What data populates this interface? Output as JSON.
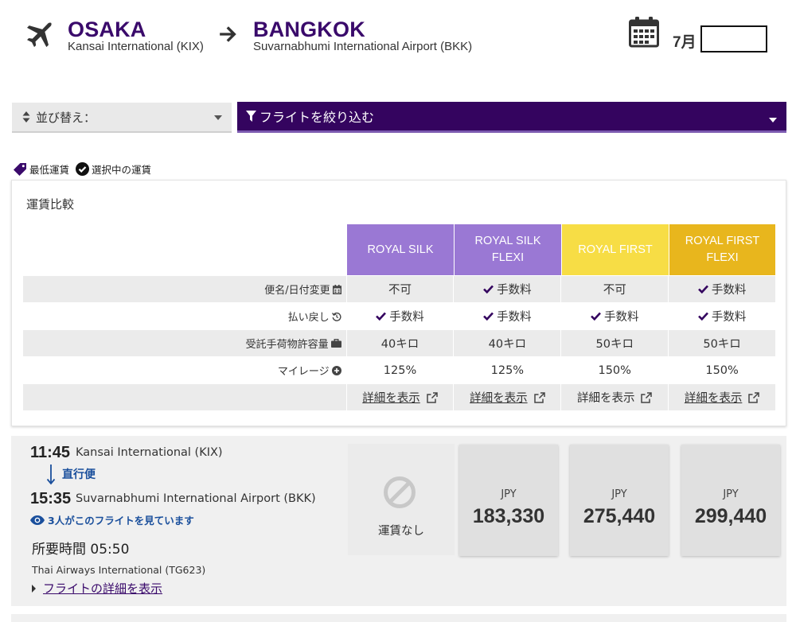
{
  "header": {
    "origin": {
      "city": "OSAKA",
      "airport": "Kansai International (KIX)"
    },
    "destination": {
      "city": "BANGKOK",
      "airport": "Suvarnabhumi International Airport (BKK)"
    },
    "month": "7月",
    "date_value": ""
  },
  "toolbar": {
    "sort_label": "並び替え：",
    "filter_label": "フライトを絞り込む"
  },
  "legend": {
    "lowest_fare": "最低運賃",
    "selected_fare": "選択中の運賃"
  },
  "comparison": {
    "title": "運賃比較",
    "fares": [
      {
        "name": "ROYAL SILK",
        "color": "#9a78d4"
      },
      {
        "name": "ROYAL SILK FLEXI",
        "color": "#9a78d4"
      },
      {
        "name": "ROYAL FIRST",
        "color": "#f7dd45"
      },
      {
        "name": "ROYAL FIRST FLEXI",
        "color": "#e8b61d"
      }
    ],
    "rows": [
      {
        "label": "便名/日付変更",
        "icon": "calendar-icon",
        "values": [
          "不可",
          "手数料",
          "不可",
          "手数料"
        ],
        "checks": [
          false,
          true,
          false,
          true
        ]
      },
      {
        "label": "払い戻し",
        "icon": "refund-icon",
        "values": [
          "手数料",
          "手数料",
          "手数料",
          "手数料"
        ],
        "checks": [
          true,
          true,
          true,
          true
        ]
      },
      {
        "label": "受託手荷物許容量",
        "icon": "baggage-icon",
        "values": [
          "40キロ",
          "40キロ",
          "50キロ",
          "50キロ"
        ],
        "checks": [
          false,
          false,
          false,
          false
        ]
      },
      {
        "label": "マイレージ",
        "icon": "plus-circle-icon",
        "values": [
          "125%",
          "125%",
          "150%",
          "150%"
        ],
        "checks": [
          false,
          false,
          false,
          false
        ]
      }
    ],
    "details_link": "詳細を表示"
  },
  "flight": {
    "departure_time": "11:45",
    "departure_airport": "Kansai International (KIX)",
    "stops": "直行便",
    "arrival_time": "15:35",
    "arrival_airport": "Suvarnabhumi International Airport (BKK)",
    "viewers": "3人がこのフライトを見ています",
    "duration": "所要時間 05:50",
    "airline": "Thai Airways International (TG623)",
    "details_link": "フライトの詳細を表示",
    "no_fare_label": "運賃なし",
    "prices": [
      {
        "currency": "JPY",
        "amount": "183,330"
      },
      {
        "currency": "JPY",
        "amount": "275,440"
      },
      {
        "currency": "JPY",
        "amount": "299,440"
      }
    ]
  },
  "colors": {
    "brand_purple": "#34045f",
    "city_text": "#3a0a6b",
    "link_blue": "#1a4f9c"
  }
}
